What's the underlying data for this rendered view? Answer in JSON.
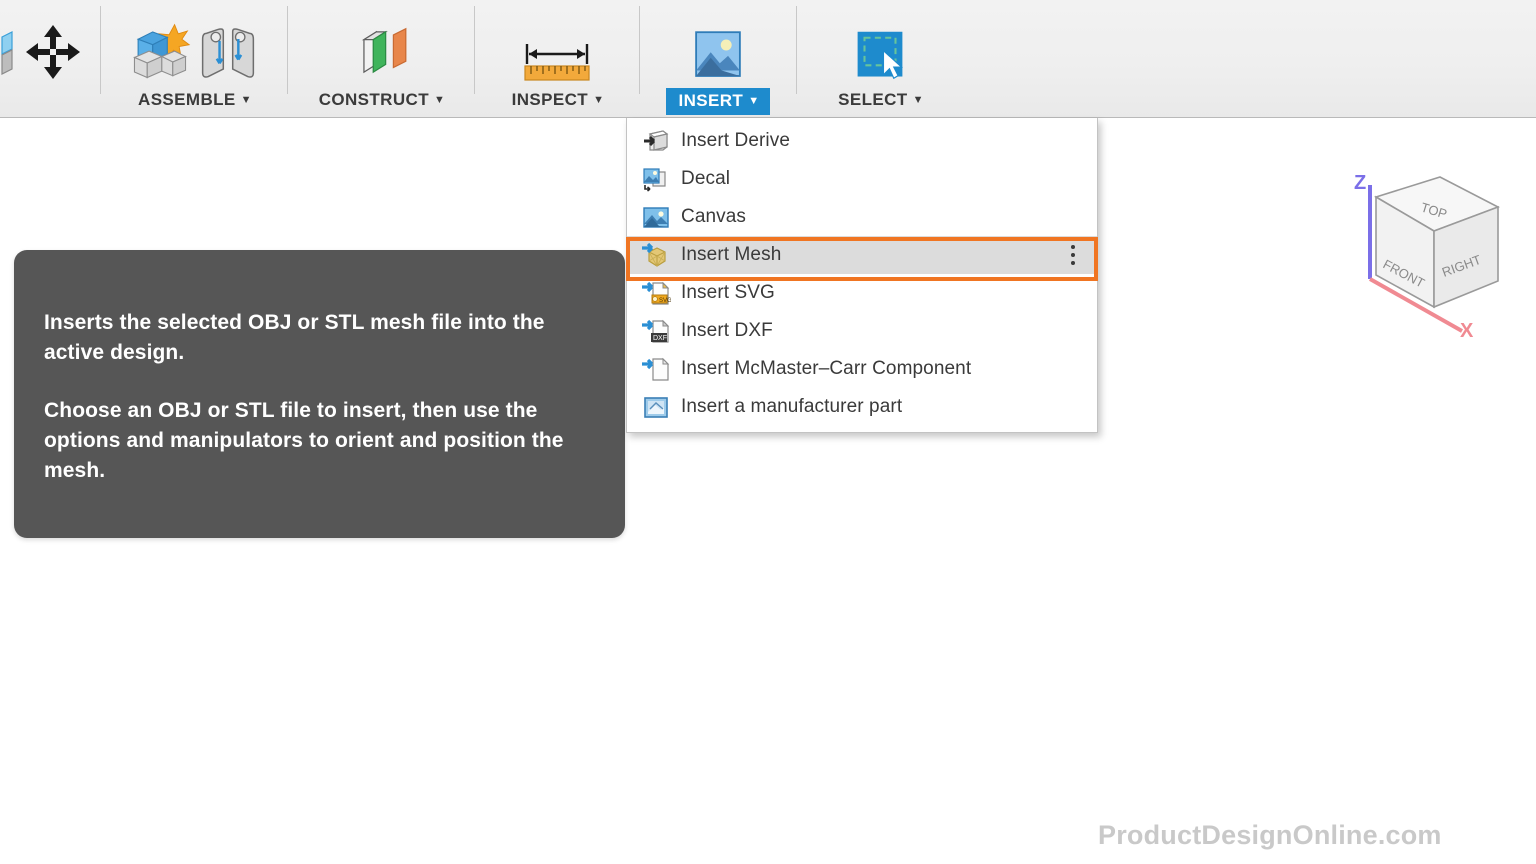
{
  "app": {
    "background_color": "#ffffff",
    "accent_color": "#1e8bcd",
    "highlight_color": "#f07522"
  },
  "toolbar": {
    "groups": [
      {
        "label": "",
        "icon": "move-icon",
        "has_caret": false
      },
      {
        "label": "ASSEMBLE",
        "caret": "▼",
        "icons": [
          "new-component-icon",
          "joint-icon"
        ]
      },
      {
        "label": "CONSTRUCT",
        "caret": "▼",
        "icons": [
          "offset-plane-icon"
        ]
      },
      {
        "label": "INSPECT",
        "caret": "▼",
        "icons": [
          "measure-icon"
        ]
      },
      {
        "label": "INSERT",
        "caret": "▼",
        "icons": [
          "insert-image-icon"
        ],
        "active": true
      },
      {
        "label": "SELECT",
        "caret": "▼",
        "icons": [
          "select-window-icon"
        ]
      }
    ]
  },
  "insert_menu": {
    "items": [
      {
        "label": "Insert Derive",
        "icon": "insert-derive-icon",
        "selected": false
      },
      {
        "label": "Decal",
        "icon": "decal-icon",
        "selected": false
      },
      {
        "label": "Canvas",
        "icon": "canvas-icon",
        "selected": false
      },
      {
        "label": "Insert Mesh",
        "icon": "insert-mesh-icon",
        "selected": true,
        "overflow": "kebab-menu"
      },
      {
        "label": "Insert SVG",
        "icon": "insert-svg-icon",
        "selected": false
      },
      {
        "label": "Insert DXF",
        "icon": "insert-dxf-icon",
        "selected": false
      },
      {
        "label": "Insert McMaster–Carr Component",
        "icon": "insert-mcmaster-icon",
        "selected": false
      },
      {
        "label": "Insert a manufacturer part",
        "icon": "insert-manufacturer-part-icon",
        "selected": false
      }
    ]
  },
  "tooltip": {
    "paragraph1": "Inserts the selected OBJ or STL mesh file into the active design.",
    "paragraph2": "Choose an OBJ or STL file to insert, then use the options and manipulators to orient and position the mesh."
  },
  "viewcube": {
    "faces": {
      "top": "TOP",
      "front": "FRONT",
      "right": "RIGHT"
    },
    "axes": {
      "z": "Z",
      "x": "X"
    },
    "z_color": "#7b6fe8",
    "x_color": "#f08a92"
  },
  "watermark": {
    "text": "ProductDesignOnline.com"
  }
}
